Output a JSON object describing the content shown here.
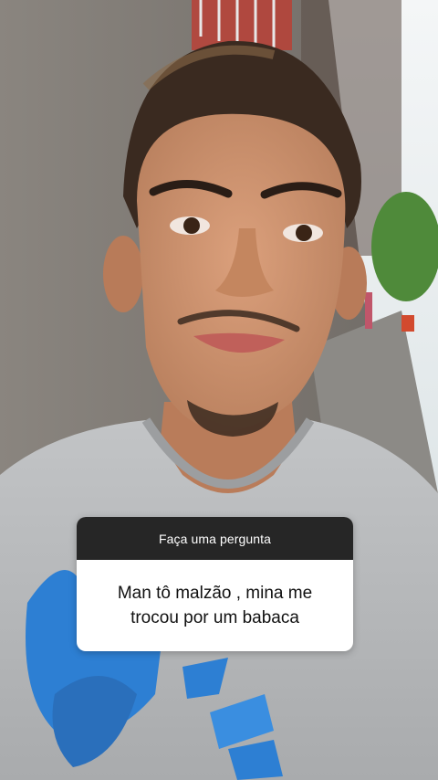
{
  "question_sticker": {
    "header": "Faça uma pergunta",
    "answer_line1": "Man tô malzão , mina me",
    "answer_line2": "trocou por um babaca"
  },
  "photo": {
    "subject": "selfie-young-man-gray-tshirt-alley",
    "colors": {
      "wall": "#7d7873",
      "skin": "#c98f6c",
      "hair": "#3a2a20",
      "shirt": "#b7b9bb",
      "shirt_print": "#2d7fd3",
      "sky": "#e9eef0",
      "tree": "#4f8a3a",
      "ground": "#8c8a86"
    }
  }
}
